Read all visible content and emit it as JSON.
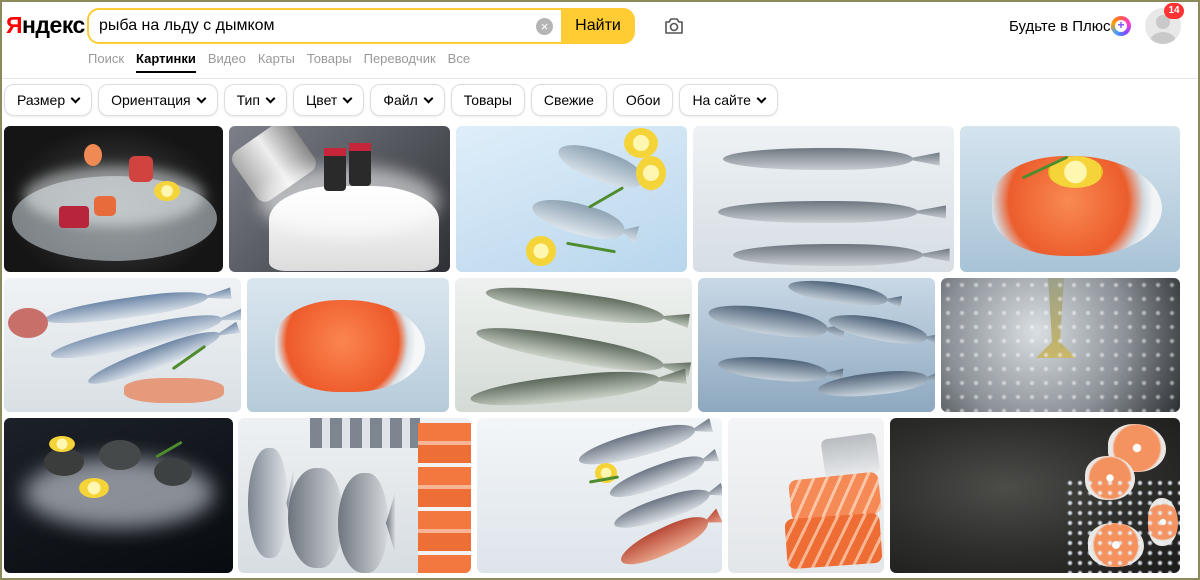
{
  "brand": {
    "logo_first": "Я",
    "logo_rest": "ндекс"
  },
  "search": {
    "query": "рыба на льду с дымком",
    "clear_glyph": "×",
    "submit_label": "Найти"
  },
  "icons": {
    "camera": "camera-icon",
    "plus": "plus-icon",
    "clear": "clear-icon",
    "avatar": "avatar",
    "chevron": "chevron-down-icon"
  },
  "header": {
    "plus_label": "Будьте в Плюсе",
    "notifications_count": "14"
  },
  "tabs": [
    {
      "label": "Поиск",
      "active": false
    },
    {
      "label": "Картинки",
      "active": true
    },
    {
      "label": "Видео",
      "active": false
    },
    {
      "label": "Карты",
      "active": false
    },
    {
      "label": "Товары",
      "active": false
    },
    {
      "label": "Переводчик",
      "active": false
    },
    {
      "label": "Все",
      "active": false
    }
  ],
  "filters": [
    {
      "label": "Размер",
      "dropdown": true
    },
    {
      "label": "Ориентация",
      "dropdown": true
    },
    {
      "label": "Тип",
      "dropdown": true
    },
    {
      "label": "Цвет",
      "dropdown": true
    },
    {
      "label": "Файл",
      "dropdown": true
    },
    {
      "label": "Товары",
      "dropdown": false
    },
    {
      "label": "Свежие",
      "dropdown": false
    },
    {
      "label": "Обои",
      "dropdown": false
    },
    {
      "label": "На сайте",
      "dropdown": true
    }
  ],
  "colors": {
    "accent": "#ffcc33",
    "badge": "#ff3333",
    "tab_inactive": "#999999"
  },
  "results_rows": [
    [
      "sushi-dish-smoke",
      "shaker-sushi-smoke",
      "dorado-lemon-ice",
      "three-trout-ice",
      "salmon-steak-dill"
    ],
    [
      "seafood-assortment",
      "salmon-steak-ice",
      "trout-on-ice",
      "fish-school-ice",
      "fish-tail-dark-ice"
    ],
    [
      "oysters-dark-smoke",
      "fish-and-salmon-ice",
      "sea-bream-ice",
      "salmon-fillets",
      "salmon-steaks-dark-board"
    ]
  ]
}
